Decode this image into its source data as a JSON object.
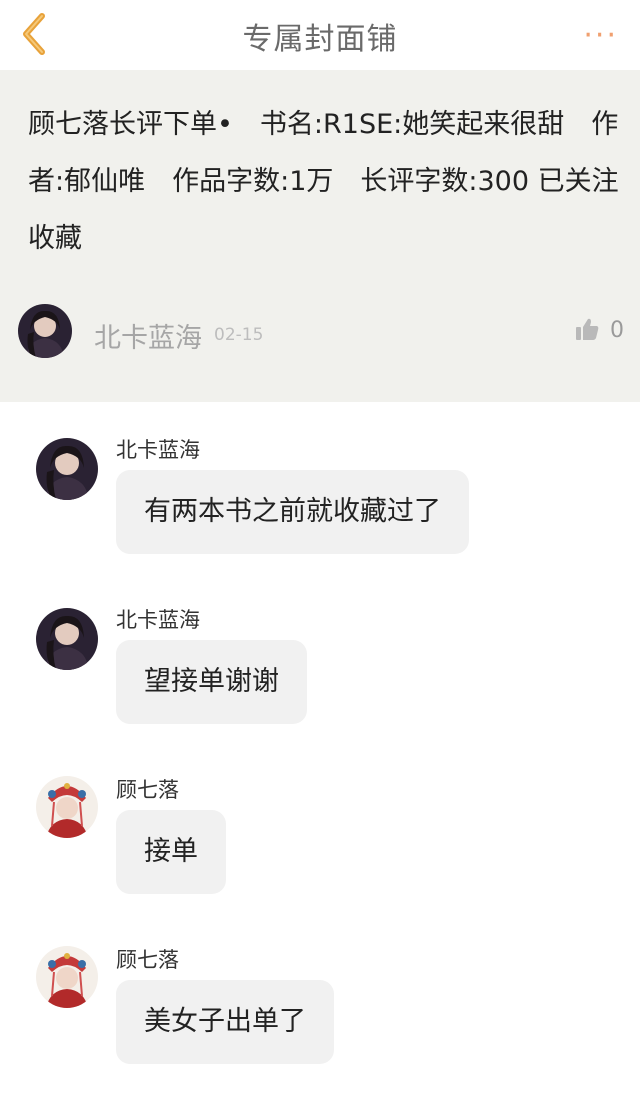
{
  "nav": {
    "title": "专属封面铺",
    "back_icon": "chevron-left-icon",
    "more_label": "···",
    "accent_color": "#e8a23a"
  },
  "post": {
    "text": "顾七落长评下单•　书名:R1SE:她笑起来很甜　作者:郁仙唯　作品字数:1万　长评字数:300 已关注收藏",
    "author": "北卡蓝海",
    "date": "02-15",
    "like_icon": "thumbs-up-icon",
    "likes": "0"
  },
  "messages": [
    {
      "author": "北卡蓝海",
      "text": "有两本书之前就收藏过了",
      "avatar": "dark-hair-woman"
    },
    {
      "author": "北卡蓝海",
      "text": "望接单谢谢",
      "avatar": "dark-hair-woman"
    },
    {
      "author": "顾七落",
      "text": "接单",
      "avatar": "red-headdress-woman"
    },
    {
      "author": "顾七落",
      "text": "美女子出单了",
      "avatar": "red-headdress-woman"
    }
  ]
}
